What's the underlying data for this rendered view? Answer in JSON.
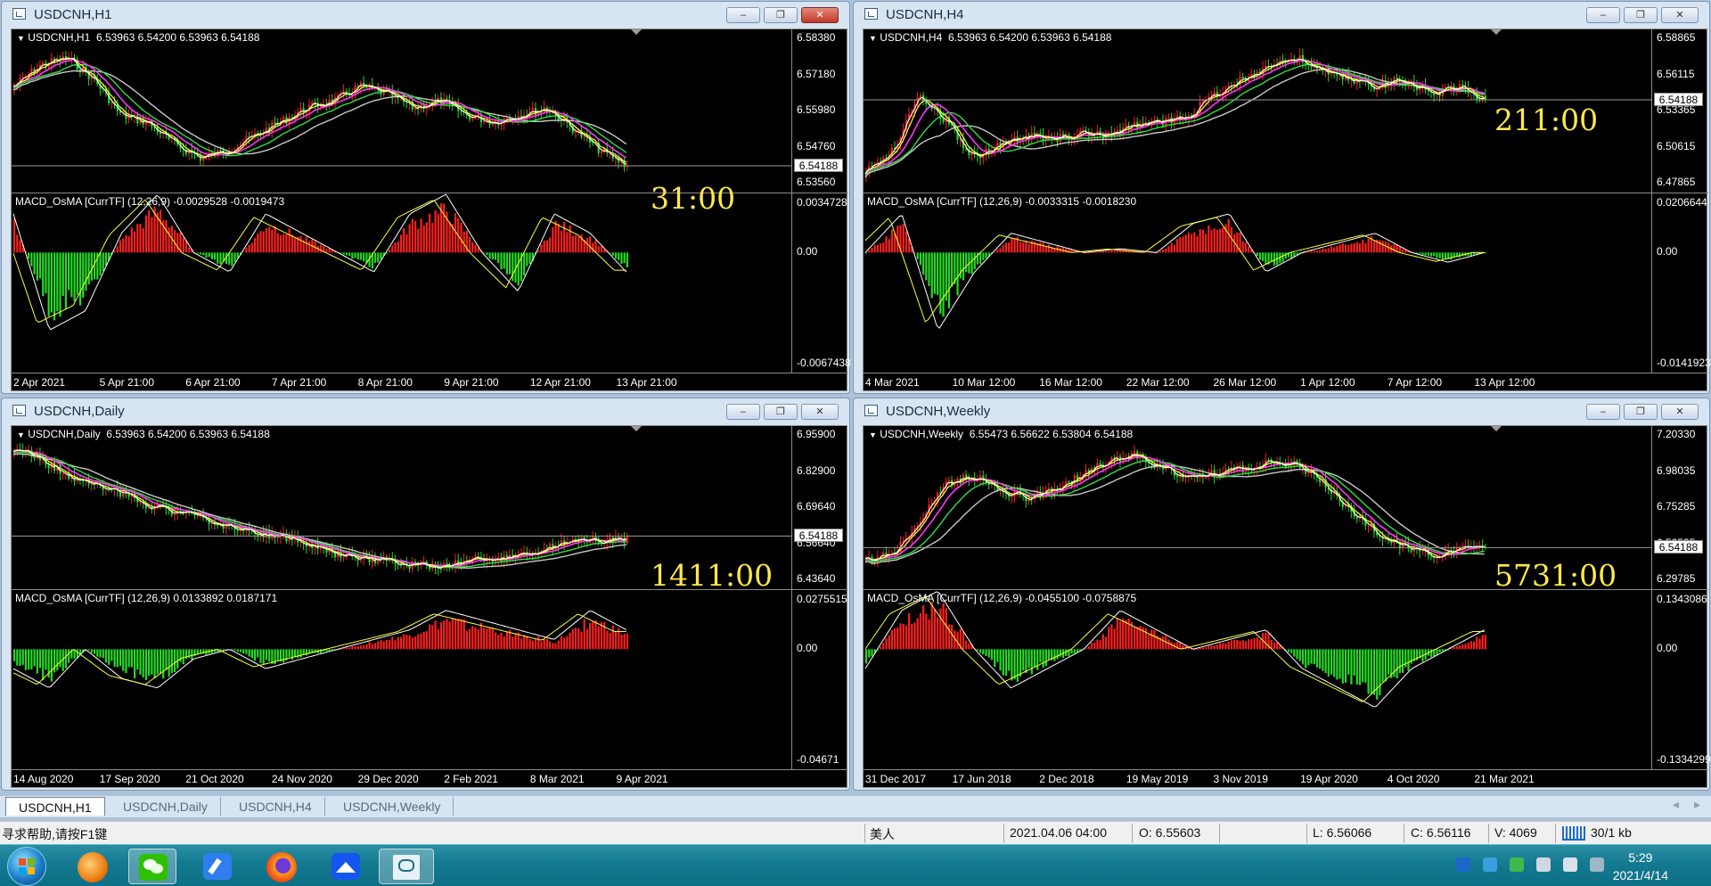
{
  "windows": [
    {
      "title": "USDCNH,H1",
      "active": true,
      "info": "USDCNH,H1  6.53963 6.54200 6.53963 6.54188",
      "prices": [
        "6.58380",
        "6.57180",
        "6.55980",
        "6.54760",
        "6.53560"
      ],
      "current_price": "6.54188",
      "timer": "31:00",
      "macd_info": "MACD_OsMA [CurrTF] (12,26,9) -0.0029528 -0.0019473",
      "macd_scale": [
        "0.0034728",
        "0.00",
        "-0.0067438"
      ],
      "time_labels": [
        "2 Apr 2021",
        "5 Apr 21:00",
        "6 Apr 21:00",
        "7 Apr 21:00",
        "8 Apr 21:00",
        "9 Apr 21:00",
        "12 Apr 21:00",
        "13 Apr 21:00"
      ],
      "buttons": {
        "minimize": "‒",
        "restore": "❐",
        "close": "✕"
      }
    },
    {
      "title": "USDCNH,H4",
      "active": false,
      "info": "USDCNH,H4  6.53963 6.54200 6.53963 6.54188",
      "prices": [
        "6.58865",
        "6.56115",
        "6.53365",
        "6.50615",
        "6.47865"
      ],
      "current_price": "6.54188",
      "timer": "211:00",
      "macd_info": "MACD_OsMA [CurrTF] (12,26,9) -0.0033315 -0.0018230",
      "macd_scale": [
        "0.0206644",
        "0.00",
        "-0.0141923"
      ],
      "time_labels": [
        "4 Mar 2021",
        "10 Mar 12:00",
        "16 Mar 12:00",
        "22 Mar 12:00",
        "26 Mar 12:00",
        "1 Apr 12:00",
        "7 Apr 12:00",
        "13 Apr 12:00"
      ],
      "buttons": {
        "minimize": "‒",
        "restore": "❐",
        "close": "✕"
      }
    },
    {
      "title": "USDCNH,Daily",
      "active": false,
      "info": "USDCNH,Daily  6.53963 6.54200 6.53963 6.54188",
      "prices": [
        "6.95900",
        "6.82900",
        "6.69640",
        "6.56640",
        "6.43640"
      ],
      "current_price": "6.54188",
      "timer": "1411:00",
      "macd_info": "MACD_OsMA [CurrTF] (12,26,9) 0.0133892 0.0187171",
      "macd_scale": [
        "0.0275515",
        "0.00",
        "-0.04671"
      ],
      "time_labels": [
        "14 Aug 2020",
        "17 Sep 2020",
        "21 Oct 2020",
        "24 Nov 2020",
        "29 Dec 2020",
        "2 Feb 2021",
        "8 Mar 2021",
        "9 Apr 2021"
      ],
      "buttons": {
        "minimize": "‒",
        "restore": "❐",
        "close": "✕"
      }
    },
    {
      "title": "USDCNH,Weekly",
      "active": false,
      "info": "USDCNH,Weekly  6.55473 6.56622 6.53804 6.54188",
      "prices": [
        "7.20330",
        "6.98035",
        "6.75285",
        "6.52535",
        "6.29785"
      ],
      "current_price": "6.54188",
      "timer": "5731:00",
      "macd_info": "MACD_OsMA [CurrTF] (12,26,9) -0.0455100 -0.0758875",
      "macd_scale": [
        "0.1343086",
        "0.00",
        "-0.1334299"
      ],
      "time_labels": [
        "31 Dec 2017",
        "17 Jun 2018",
        "2 Dec 2018",
        "19 May 2019",
        "3 Nov 2019",
        "19 Apr 2020",
        "4 Oct 2020",
        "21 Mar 2021"
      ],
      "buttons": {
        "minimize": "‒",
        "restore": "❐",
        "close": "✕"
      }
    }
  ],
  "tabs": [
    "USDCNH,H1",
    "USDCNH,Daily",
    "USDCNH,H4",
    "USDCNH,Weekly"
  ],
  "tab_scroll": {
    "left": "◂",
    "right": "▸"
  },
  "status": {
    "help": "寻求帮助,请按F1键",
    "profile": "美人",
    "datetime": "2021.04.06 04:00",
    "open": "O: 6.55603",
    "low": "L: 6.56066",
    "close": "C: 6.56116",
    "volume": "V: 4069",
    "traffic": "30/1 kb"
  },
  "taskbar": {
    "time": "5:29",
    "date": "2021/4/14",
    "apps": [
      "start-orb",
      "app-orange",
      "wechat",
      "notes-app",
      "firefox",
      "feishu",
      "trading-terminal"
    ]
  },
  "colors": {
    "bull": "#ff1f1f",
    "bear": "#22dd22",
    "ma_fast": "#ffffff",
    "ma_yellow": "#ffff33",
    "ma_magenta": "#ff33ff",
    "ma_green": "#33dd44",
    "ma_slow": "#c8c8c8",
    "timer": "#ffe84a"
  }
}
